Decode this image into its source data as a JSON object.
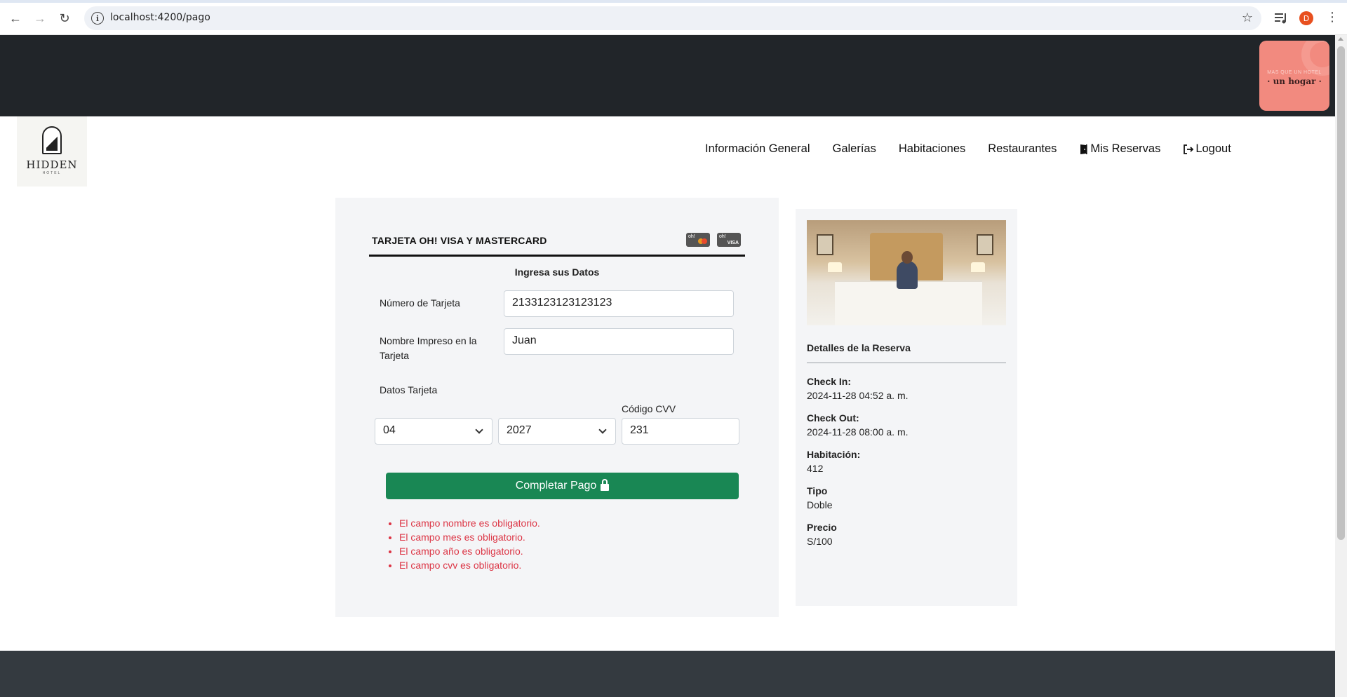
{
  "browser": {
    "url": "localhost:4200/pago",
    "profile_initial": "D"
  },
  "promo": {
    "line1": "MAS QUE UN HOTEL",
    "line2": "· un hogar ·"
  },
  "logo": {
    "name": "HIDDEN",
    "sub": "HOTEL"
  },
  "nav": {
    "items": [
      {
        "label": "Información General"
      },
      {
        "label": "Galerías"
      },
      {
        "label": "Habitaciones"
      },
      {
        "label": "Restaurantes"
      },
      {
        "label": "Mis Reservas",
        "icon": "door-icon"
      },
      {
        "label": "Logout",
        "icon": "logout-icon"
      }
    ]
  },
  "payment": {
    "card_title": "TARJETA OH! VISA Y MASTERCARD",
    "card_logos": [
      "oh!",
      "oh!"
    ],
    "card_logo_visa": "VISA",
    "subtitle": "Ingresa sus Datos",
    "card_number_label": "Número de Tarjeta",
    "card_number_value": "2133123123123123",
    "name_label": "Nombre Impreso en la Tarjeta",
    "name_value": "Juan",
    "card_data_label": "Datos Tarjeta",
    "month_value": "04",
    "year_value": "2027",
    "cvv_label": "Código CVV",
    "cvv_value": "231",
    "submit_label": "Completar Pago",
    "errors": [
      "El campo nombre es obligatorio.",
      "El campo mes es obligatorio.",
      "El campo año es obligatorio.",
      "El campo cvv es obligatorio."
    ],
    "colors": {
      "button": "#198754",
      "error": "#dc3545"
    }
  },
  "reservation": {
    "title": "Detalles de la Reserva",
    "checkin_label": "Check In:",
    "checkin_value": "2024-11-28 04:52 a. m.",
    "checkout_label": "Check Out:",
    "checkout_value": "2024-11-28 08:00 a. m.",
    "room_label": "Habitación:",
    "room_value": "412",
    "type_label": "Tipo",
    "type_value": "Doble",
    "price_label": "Precio",
    "price_value": "S/100"
  }
}
